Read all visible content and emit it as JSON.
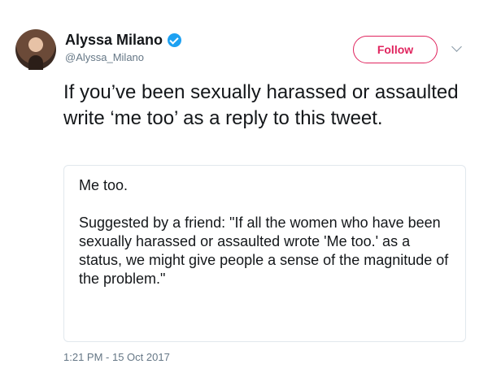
{
  "author": {
    "display_name": "Alyssa Milano",
    "handle": "@Alyssa_Milano",
    "verified_icon": "verified-badge-icon"
  },
  "actions": {
    "follow_label": "Follow",
    "menu_icon": "chevron-down-icon"
  },
  "tweet": {
    "text": "If you’ve been sexually harassed or assaulted write ‘me too’ as a reply to this tweet."
  },
  "quote": {
    "first_line": "Me too.",
    "body": "Suggested by a friend: \"If all the women who have been sexually harassed or assaulted wrote 'Me too.' as a status, we might give people a sense of the magnitude of the problem.\""
  },
  "timestamp": "1:21 PM - 15 Oct 2017",
  "colors": {
    "accent": "#e0245e",
    "verified": "#1da1f2",
    "secondary_text": "#657786",
    "border": "#e1e8ed"
  }
}
